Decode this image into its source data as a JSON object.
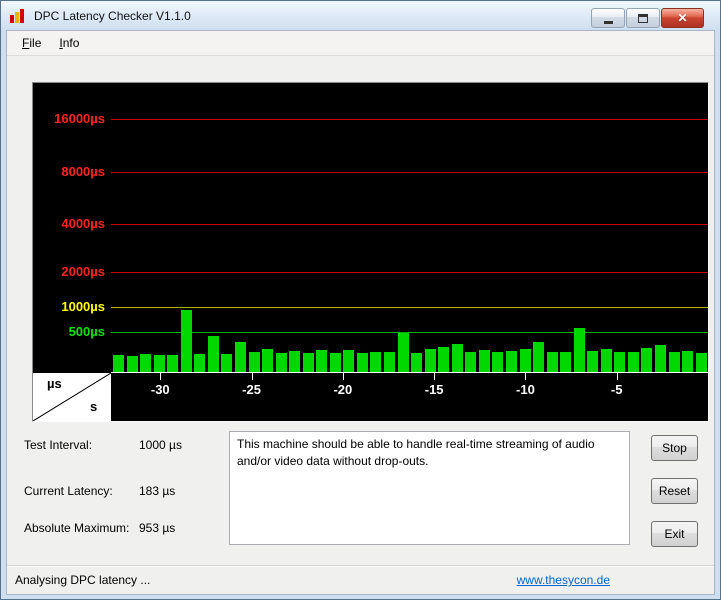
{
  "window": {
    "title": "DPC Latency Checker V1.1.0",
    "controls": [
      {
        "name": "minimize"
      },
      {
        "name": "maximize"
      },
      {
        "name": "close"
      }
    ]
  },
  "menu": {
    "items": [
      {
        "label": "File",
        "underline": 0
      },
      {
        "label": "Info",
        "underline": 0
      }
    ]
  },
  "chart_data": {
    "type": "bar",
    "title": "DPC latency over time",
    "background": "#000000",
    "bar_color": "#00d800",
    "y_axis": {
      "unit": "µs",
      "scale": "log-like",
      "gridlines": [
        {
          "value": 500,
          "label": "500µs",
          "label_color": "#00e400",
          "line_color": "#00b000"
        },
        {
          "value": 1000,
          "label": "1000µs",
          "label_color": "#ffff00",
          "line_color": "#b4b400"
        },
        {
          "value": 2000,
          "label": "2000µs",
          "label_color": "#ff2222",
          "line_color": "#c80000"
        },
        {
          "value": 4000,
          "label": "4000µs",
          "label_color": "#ff2222",
          "line_color": "#c80000"
        },
        {
          "value": 8000,
          "label": "8000µs",
          "label_color": "#ff2222",
          "line_color": "#c80000"
        },
        {
          "value": 16000,
          "label": "16000µs",
          "label_color": "#ff2222",
          "line_color": "#c80000"
        }
      ]
    },
    "x_axis": {
      "unit": "s",
      "ticks": [
        -30,
        -25,
        -20,
        -15,
        -10,
        -5
      ],
      "range": [
        -32.7,
        0
      ]
    },
    "corner": {
      "top_label": "µs",
      "bottom_label": "s"
    },
    "values_us": [
      228,
      215,
      238,
      222,
      230,
      953,
      238,
      462,
      232,
      385,
      268,
      298,
      248,
      272,
      244,
      282,
      254,
      290,
      250,
      268,
      258,
      505,
      248,
      298,
      330,
      362,
      268,
      288,
      258,
      278,
      298,
      392,
      268,
      258,
      592,
      278,
      298,
      258,
      268,
      318,
      352,
      258,
      272,
      248
    ]
  },
  "stats": [
    {
      "label": "Test Interval:",
      "value": "1000 µs"
    },
    {
      "label": "Current Latency:",
      "value": "183 µs"
    },
    {
      "label": "Absolute Maximum:",
      "value": "953 µs"
    }
  ],
  "message": "This machine should be able to handle real-time streaming of audio and/or video data without drop-outs.",
  "buttons": [
    {
      "label": "Stop"
    },
    {
      "label": "Reset"
    },
    {
      "label": "Exit"
    }
  ],
  "statusbar": {
    "text": "Analysing DPC latency ...",
    "link": "www.thesycon.de"
  }
}
